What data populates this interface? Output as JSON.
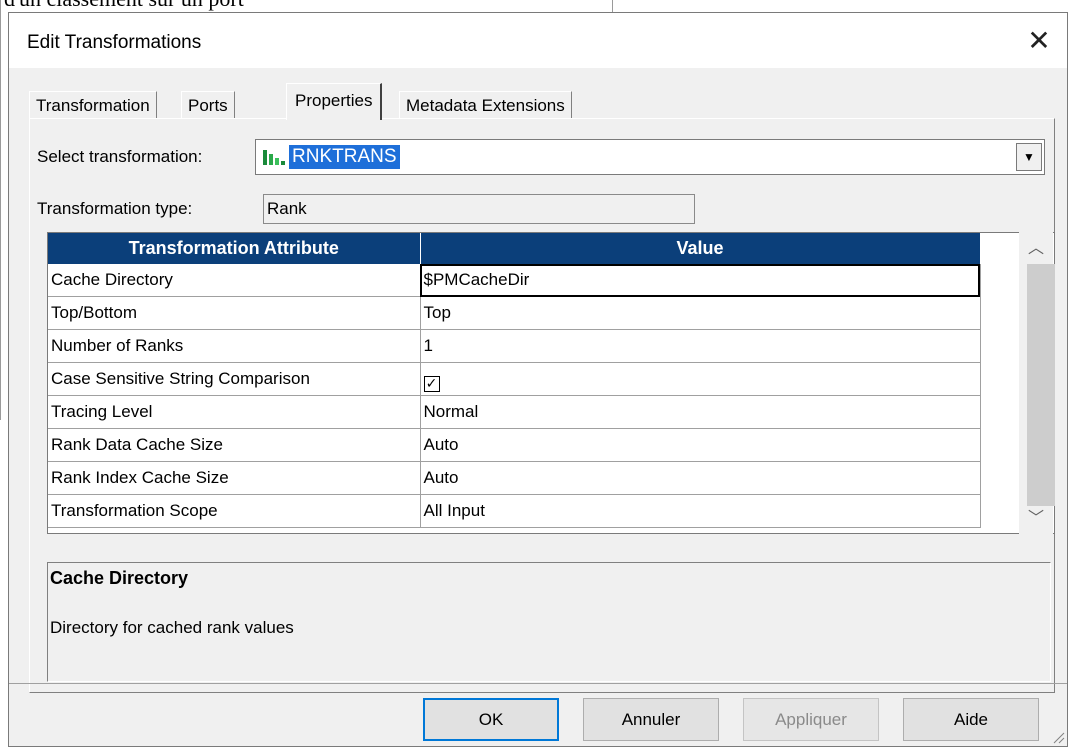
{
  "background": {
    "text": "d'un classement sur un port"
  },
  "dialog": {
    "title": "Edit Transformations",
    "tabs": [
      {
        "label": "Transformation",
        "active": false
      },
      {
        "label": "Ports",
        "active": false
      },
      {
        "label": "Properties",
        "active": true
      },
      {
        "label": "Metadata Extensions",
        "active": false
      }
    ],
    "select_transformation": {
      "label": "Select transformation:",
      "value": "RNKTRANS",
      "icon": "rank-transformation-icon"
    },
    "transformation_type": {
      "label": "Transformation type:",
      "value": "Rank"
    },
    "table": {
      "headers": [
        "Transformation Attribute",
        "Value"
      ],
      "rows": [
        {
          "attribute": "Cache Directory",
          "value": "$PMCacheDir",
          "selected": true
        },
        {
          "attribute": "Top/Bottom",
          "value": "Top"
        },
        {
          "attribute": "Number of Ranks",
          "value": "1"
        },
        {
          "attribute": "Case Sensitive String Comparison",
          "value": "",
          "checkbox": true
        },
        {
          "attribute": "Tracing Level",
          "value": "Normal"
        },
        {
          "attribute": "Rank Data Cache Size",
          "value": "Auto"
        },
        {
          "attribute": "Rank Index Cache Size",
          "value": "Auto"
        },
        {
          "attribute": "Transformation Scope",
          "value": "All Input"
        }
      ]
    },
    "description": {
      "title": "Cache Directory",
      "text": "Directory for cached rank values"
    },
    "buttons": {
      "ok": "OK",
      "cancel": "Annuler",
      "apply": "Appliquer",
      "help": "Aide"
    },
    "colors": {
      "header_bg": "#0b3f7a",
      "selection": "#1e6fd9",
      "default_button_border": "#0078d7"
    }
  }
}
